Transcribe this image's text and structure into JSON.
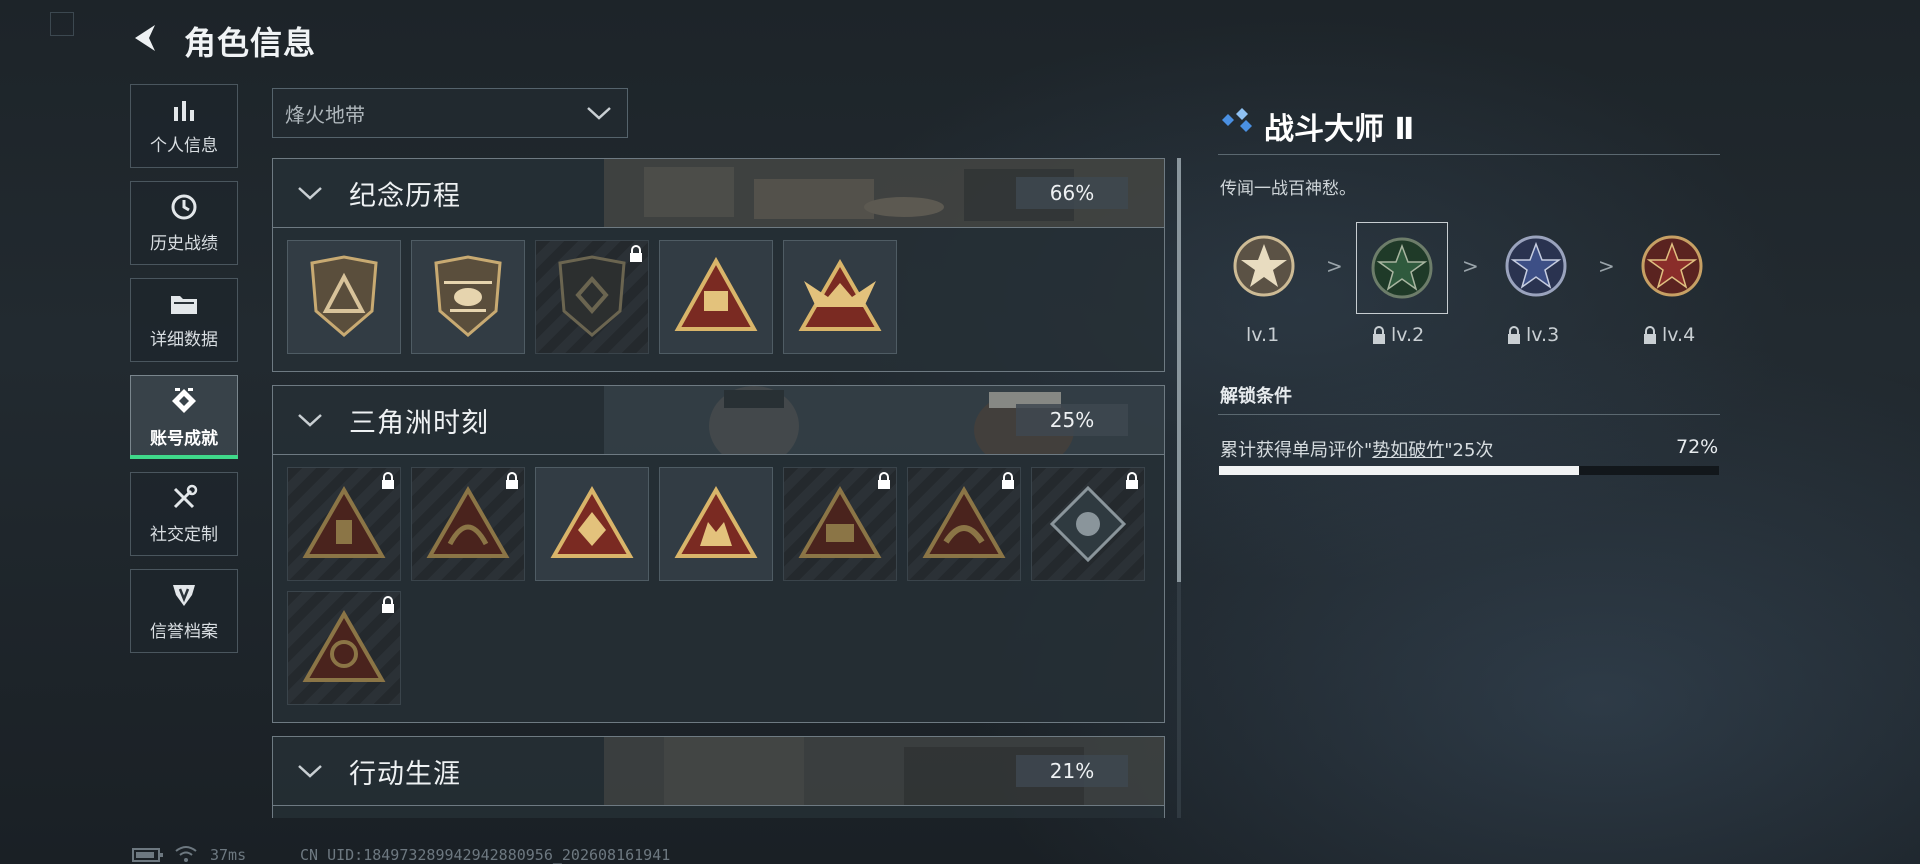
{
  "header": {
    "title": "角色信息"
  },
  "sidebar": {
    "items": [
      {
        "label": "个人信息",
        "icon": "bar-chart-icon"
      },
      {
        "label": "历史战绩",
        "icon": "clock-icon"
      },
      {
        "label": "详细数据",
        "icon": "folder-icon"
      },
      {
        "label": "账号成就",
        "icon": "achievement-icon",
        "active": true
      },
      {
        "label": "社交定制",
        "icon": "tools-icon"
      },
      {
        "label": "信誉档案",
        "icon": "shield-icon"
      }
    ],
    "active_color": "#3fd98a"
  },
  "filter": {
    "selected": "烽火地带"
  },
  "sections": [
    {
      "title": "纪念历程",
      "percent": "66%",
      "badges": [
        false,
        false,
        true,
        false,
        false
      ]
    },
    {
      "title": "三角洲时刻",
      "percent": "25%",
      "badges": [
        true,
        true,
        false,
        false,
        true,
        true,
        true,
        true
      ]
    },
    {
      "title": "行动生涯",
      "percent": "21%"
    }
  ],
  "detail": {
    "title": "战斗大师 Ⅱ",
    "description": "传闻一战百神愁。",
    "levels": [
      {
        "label": "lv.1",
        "locked": false,
        "color": "#cdbb95"
      },
      {
        "label": "lv.2",
        "locked": true,
        "color": "#2f5a3d",
        "selected": true
      },
      {
        "label": "lv.3",
        "locked": true,
        "color": "#3d4f86"
      },
      {
        "label": "lv.4",
        "locked": true,
        "color": "#8a2d2a"
      }
    ],
    "separator": ">",
    "unlock_title": "解锁条件",
    "condition": {
      "prefix": "累计获得单局评价\"",
      "highlight": "势如破竹",
      "suffix": "\"25次"
    },
    "progress_label": "72%",
    "progress": 0.72
  },
  "status_bar": {
    "ping": "37ms",
    "uid": "CN UID:1849732899429428809​56_202608161941"
  }
}
